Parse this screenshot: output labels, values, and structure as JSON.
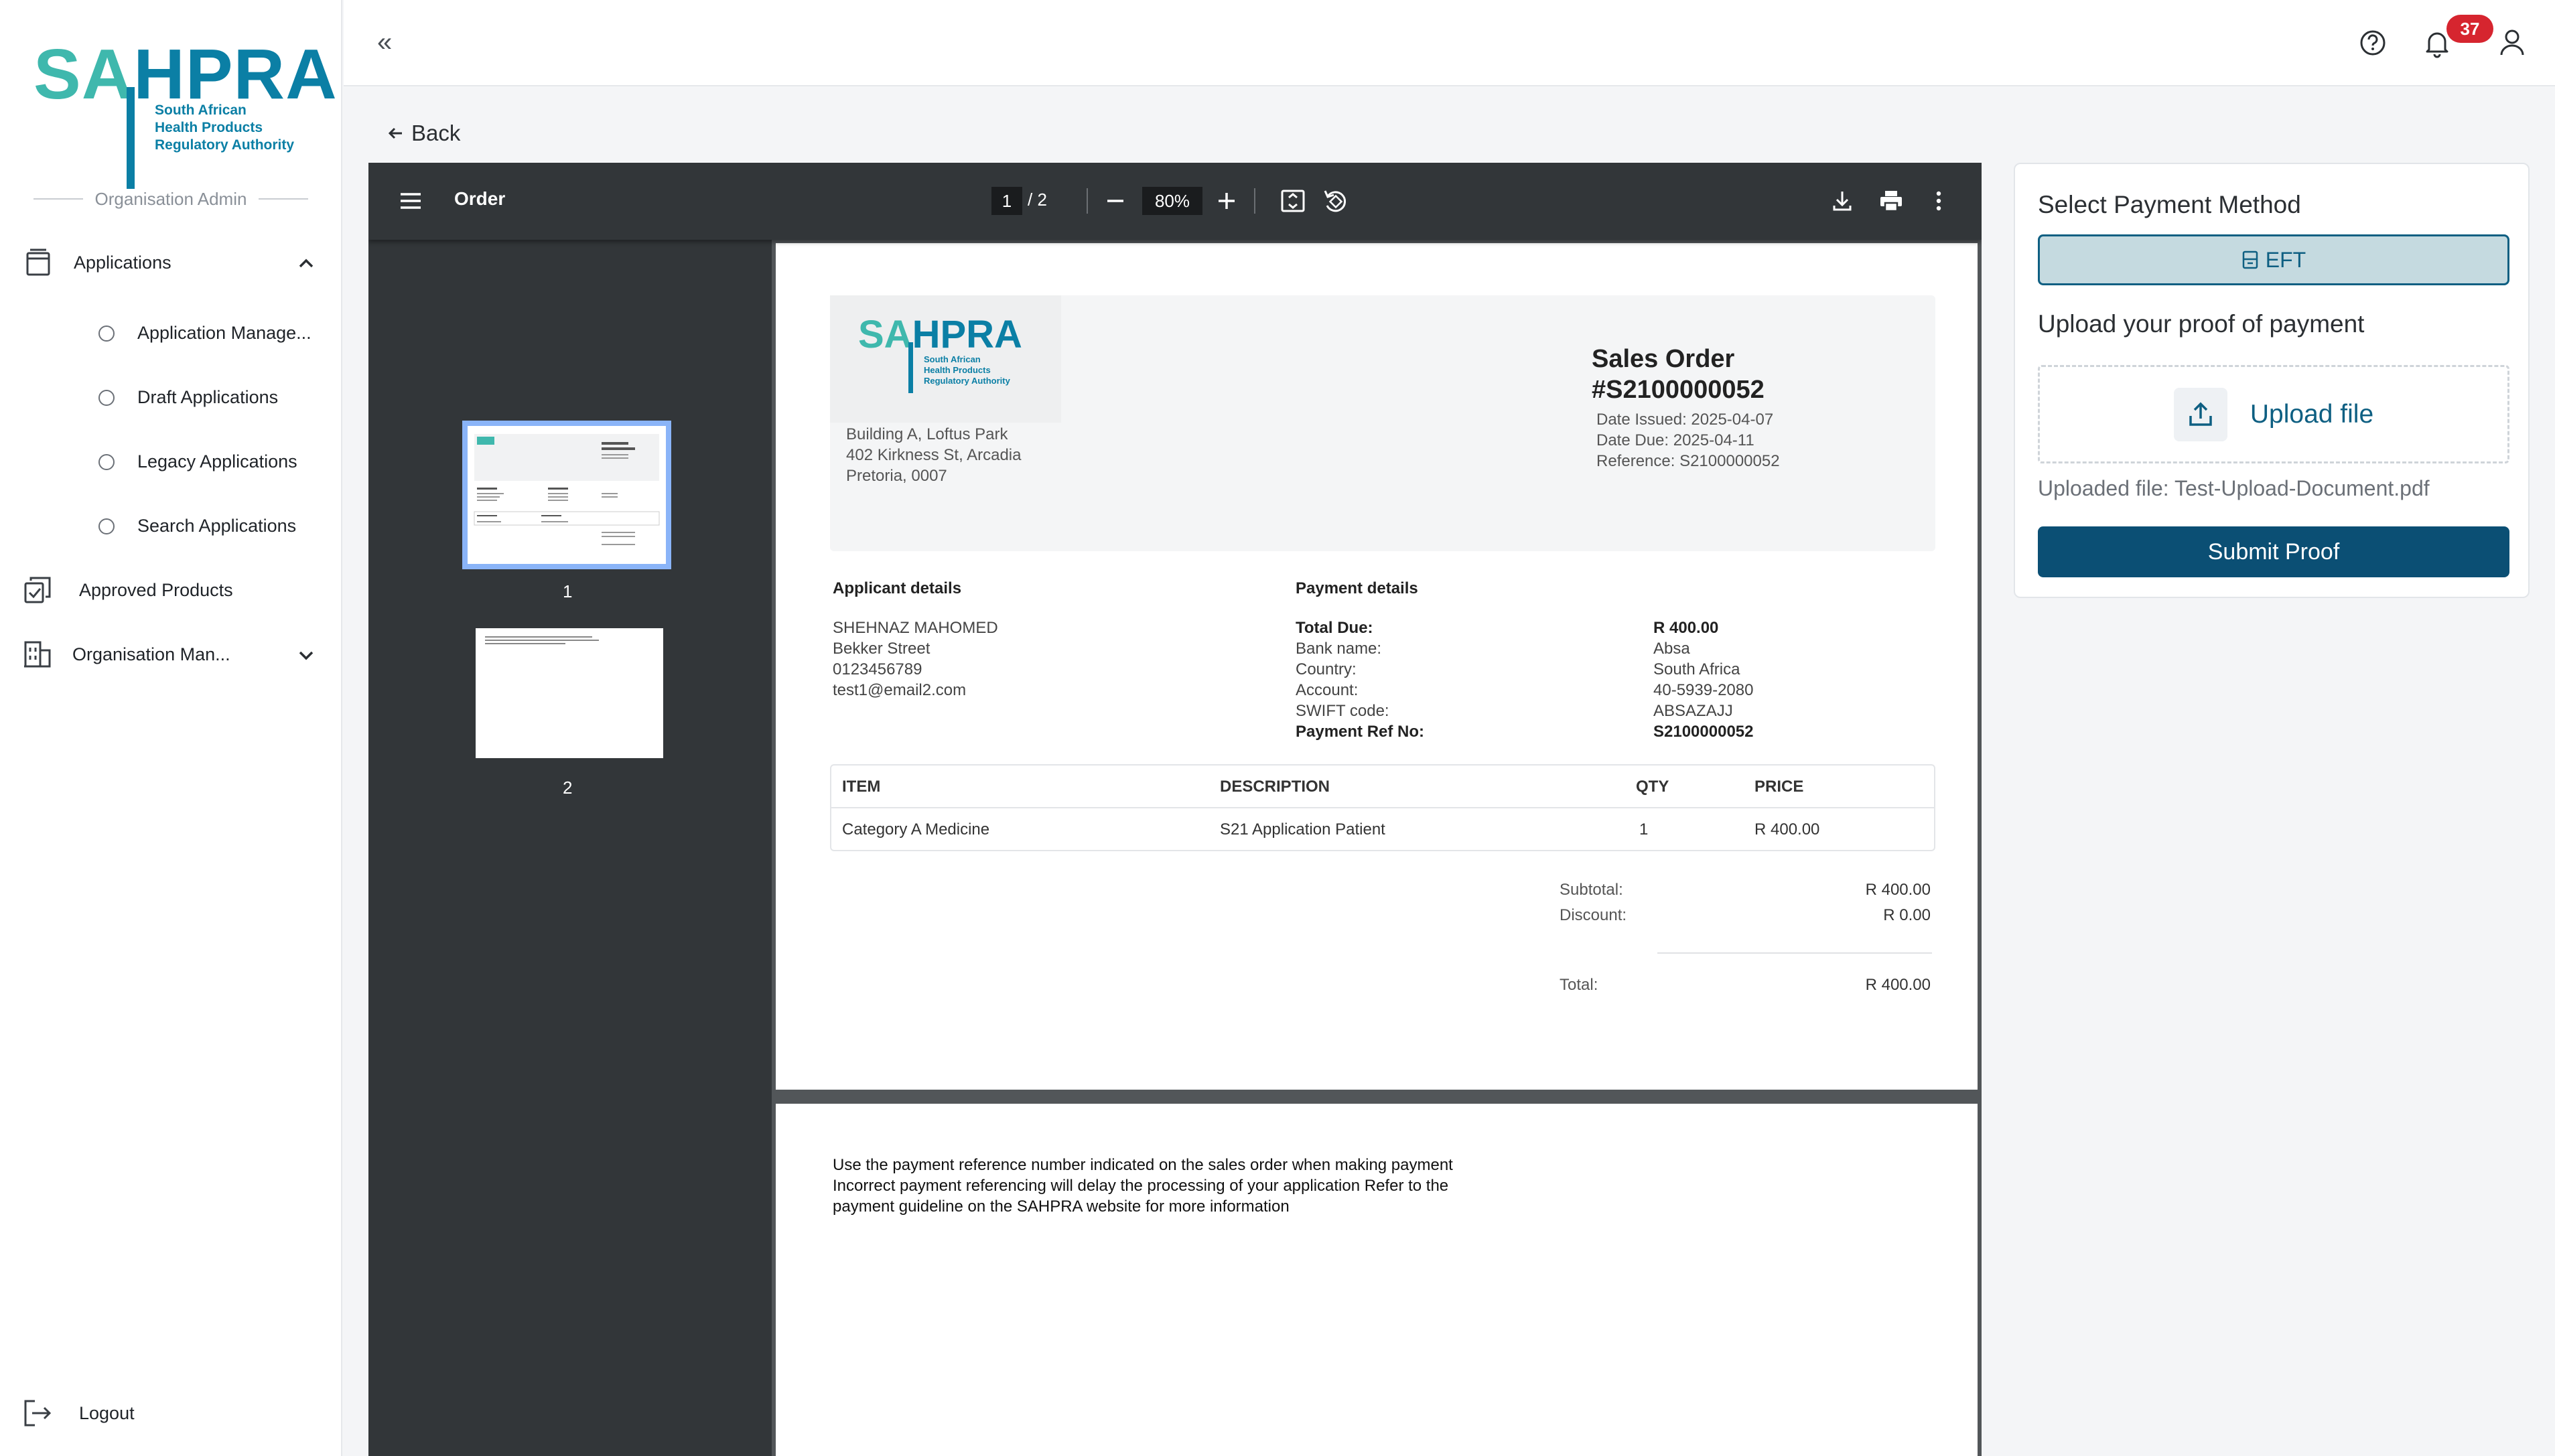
{
  "sidebar": {
    "logo": {
      "word_left": "SA",
      "word_right": "HPRA",
      "subtitle_lines": [
        "South African",
        "Health Products",
        "Regulatory Authority"
      ]
    },
    "role_label": "Organisation Admin",
    "nav": {
      "applications": "Applications",
      "sub_items": [
        "Application Manage...",
        "Draft Applications",
        "Legacy Applications",
        "Search Applications"
      ],
      "approved_products": "Approved Products",
      "organisation": "Organisation Man...",
      "logout": "Logout"
    }
  },
  "topbar": {
    "collapse_glyph": "«",
    "notification_count": "37",
    "icons": [
      "help-icon",
      "bell-icon",
      "user-icon"
    ]
  },
  "back_label": "Back",
  "viewer": {
    "title": "Order",
    "current_page": "1",
    "page_total": "/ 2",
    "zoom": "80%",
    "thumbs": [
      "1",
      "2"
    ]
  },
  "invoice": {
    "logo": {
      "word_left": "SA",
      "word_right": "HPRA",
      "subtitle_lines": [
        "South African",
        "Health Products",
        "Regulatory Authority"
      ]
    },
    "address": [
      "Building A, Loftus Park",
      "402 Kirkness St, Arcadia",
      "Pretoria, 0007"
    ],
    "title_line1": "Sales Order",
    "title_line2": "#S2100000052",
    "meta": [
      "Date Issued: 2025-04-07",
      "Date Due: 2025-04-11",
      "Reference: S2100000052"
    ],
    "applicant_heading": "Applicant details",
    "applicant": [
      "SHEHNAZ MAHOMED",
      "Bekker Street",
      "0123456789",
      "test1@email2.com"
    ],
    "payment_heading": "Payment details",
    "payment_labels": [
      "Total Due:",
      "Bank name:",
      "Country:",
      "Account:",
      "SWIFT code:",
      "Payment Ref No:"
    ],
    "payment_values": [
      "R 400.00",
      "Absa",
      "South Africa",
      "40-5939-2080",
      "ABSAZAJJ",
      "S2100000052"
    ],
    "table": {
      "headers": [
        "ITEM",
        "DESCRIPTION",
        "QTY",
        "PRICE"
      ],
      "row": [
        "Category A Medicine",
        "S21 Application Patient",
        "1",
        "R 400.00"
      ]
    },
    "totals": {
      "subtotal_label": "Subtotal:",
      "subtotal": "R 400.00",
      "discount_label": "Discount:",
      "discount": "R 0.00",
      "total_label": "Total:",
      "total": "R 400.00"
    },
    "page2_notice": [
      "Use the payment reference number indicated on the sales order when making payment",
      "Incorrect payment referencing will delay the processing of your application Refer to the",
      "payment guideline on the SAHPRA website for more information"
    ]
  },
  "payment_panel": {
    "heading": "Select Payment Method",
    "method_label": "EFT",
    "upload_heading": "Upload your proof of payment",
    "upload_label": "Upload file",
    "uploaded_file": "Uploaded file: Test-Upload-Document.pdf",
    "submit_label": "Submit Proof"
  },
  "colors": {
    "brand_teal": "#3fb8ad",
    "brand_blue": "#0b7fa5",
    "primary": "#0b4f74",
    "badge": "#d6252f"
  }
}
